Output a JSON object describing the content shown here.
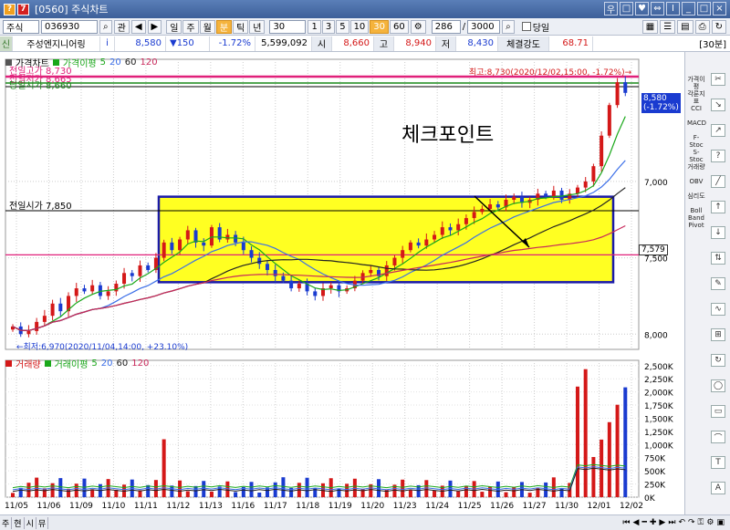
{
  "window": {
    "title": "[0560] 주식차트",
    "icon_q": "?",
    "icon_7": "7",
    "controls": [
      "우",
      "□",
      "♥",
      "⇔",
      "I",
      "_",
      "□",
      "×"
    ]
  },
  "toolbar": {
    "type_select": "주식",
    "code": "036930",
    "btn_gwan": "관",
    "periods": [
      "일",
      "주",
      "월",
      "분",
      "틱",
      "년"
    ],
    "period_active": "분",
    "interval": "30",
    "minute_buttons": [
      "1",
      "3",
      "5",
      "10",
      "30",
      "60"
    ],
    "minute_active": "30",
    "count": "286",
    "total": "3000",
    "today_label": "당일"
  },
  "infobar": {
    "mark": "신",
    "name": "주성엔지니어링",
    "info_icon": "i",
    "price": "8,580",
    "change": "▼150",
    "change_rate": "-1.72%",
    "volume": "5,599,092",
    "open_label": "시",
    "open": "8,660",
    "high_label": "고",
    "high": "8,940",
    "low_label": "저",
    "low": "8,430",
    "strength_label": "체결강도",
    "strength": "68.71",
    "unit": "[30분]"
  },
  "price_legend": {
    "chart": "가격차트",
    "ma_label": "가격이평",
    "ma": [
      "5",
      "20",
      "60",
      "120"
    ]
  },
  "volume_legend": {
    "vol": "거래량",
    "ma_label": "거래이평",
    "ma": [
      "5",
      "20",
      "60",
      "120"
    ]
  },
  "annotations": {
    "prev_high": "전일고가 8,730",
    "prev_low": "전일저가 8,665",
    "prev_low2": "당일시가 8,660",
    "prev_open": "전일시가 7,850",
    "max_label": "최고:8,730(2020/12/02,15:00, -1.72%)→",
    "min_label": "←최저:6,970(2020/11/04,14:00, +23.10%)",
    "checkpoint": "체크포인트",
    "cur_price": "8,580",
    "cur_rate": "(-1.72%)",
    "line_price": "7,579"
  },
  "y_price_ticks": [
    "8,000",
    "7,500",
    "7,000"
  ],
  "y_vol_ticks": [
    "2,500K",
    "2,250K",
    "2,000K",
    "1,750K",
    "1,500K",
    "1,250K",
    "1,000K",
    "750K",
    "500K",
    "250K",
    "0K"
  ],
  "x_ticks": [
    "11/05",
    "11/06",
    "11/09",
    "11/10",
    "11/11",
    "11/12",
    "11/13",
    "11/16",
    "11/17",
    "11/18",
    "11/19",
    "11/20",
    "11/23",
    "11/24",
    "11/25",
    "11/26",
    "11/27",
    "11/30",
    "12/01",
    "12/02"
  ],
  "right_panel": [
    "가격이평",
    "각룬지표",
    "CCI",
    "MACD",
    "F-Stoc",
    "S-Stoc",
    "거래량",
    "OBV",
    "심리도",
    "Boll Band",
    "Pivot"
  ],
  "bottom_tabs": [
    "주",
    "현",
    "시",
    "뮤"
  ],
  "colors": {
    "box_fill": "#ffff22",
    "box_border": "#1a1aa8",
    "up": "#d41818",
    "down": "#1a3bd0",
    "ma5": "#1aa81a",
    "ma20": "#3a6ee8",
    "ma60": "#222222",
    "ma120": "#c8285a"
  },
  "chart_data": {
    "type": "candlestick",
    "price_panel": {
      "ylim": [
        6900,
        8800
      ],
      "ticks": [
        7000,
        7500,
        8000
      ],
      "close_series": [
        7050,
        7000,
        7020,
        7080,
        7120,
        7200,
        7150,
        7250,
        7300,
        7280,
        7320,
        7250,
        7280,
        7330,
        7400,
        7380,
        7450,
        7420,
        7500,
        7600,
        7550,
        7620,
        7680,
        7600,
        7580,
        7700,
        7620,
        7650,
        7600,
        7550,
        7500,
        7460,
        7420,
        7380,
        7350,
        7300,
        7330,
        7280,
        7250,
        7300,
        7320,
        7280,
        7300,
        7350,
        7400,
        7420,
        7380,
        7450,
        7500,
        7550,
        7600,
        7580,
        7620,
        7650,
        7700,
        7680,
        7720,
        7760,
        7800,
        7820,
        7850,
        7830,
        7880,
        7900,
        7860,
        7880,
        7920,
        7900,
        7940,
        7880,
        7920,
        7960,
        8000,
        8100,
        8300,
        8500,
        8650,
        8580
      ],
      "prev_open_line": 7850,
      "line_7579": 7579
    },
    "volume_panel": {
      "ylim": [
        0,
        2600
      ],
      "unit": "K"
    }
  }
}
